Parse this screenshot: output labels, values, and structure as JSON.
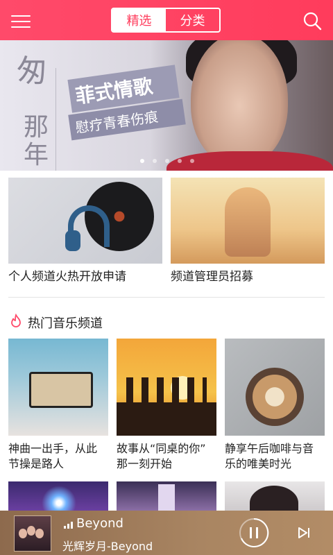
{
  "header": {
    "tabs": [
      {
        "label": "精选",
        "active": true
      },
      {
        "label": "分类",
        "active": false
      }
    ]
  },
  "banner": {
    "vertical_text": [
      "匆",
      "那",
      "年"
    ],
    "title": "菲式情歌",
    "subtitle": "慰疗青春伤痕",
    "page_count": 5,
    "current_page": 1
  },
  "featured": [
    {
      "label": "个人频道火热开放申请"
    },
    {
      "label": "频道管理员招募"
    }
  ],
  "section": {
    "title": "热门音乐频道"
  },
  "channels": [
    {
      "label": "神曲一出手，从此节操是路人",
      "line1": "神曲一出手，从此",
      "line2": "节操是路人"
    },
    {
      "label": "故事从“同桌的你”那一刻开始",
      "line1": "故事从“同桌的你”",
      "line2": "那一刻开始"
    },
    {
      "label": "静享午后咖啡与音乐的唯美时光",
      "line1": "静享午后咖啡与音",
      "line2": "乐的唯美时光"
    }
  ],
  "player": {
    "artist": "Beyond",
    "track": "光辉岁月-Beyond"
  },
  "colors": {
    "accent": "#ff3c5c",
    "player_bg": "#a98562"
  },
  "icons": [
    "menu-icon",
    "search-icon",
    "fire-icon",
    "pause-icon",
    "next-icon"
  ]
}
